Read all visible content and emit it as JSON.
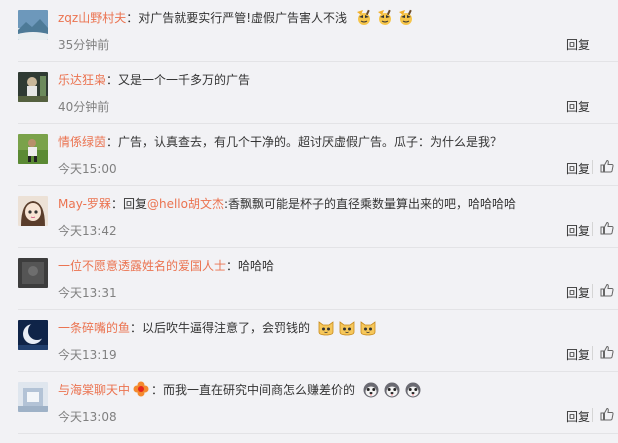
{
  "comments": [
    {
      "user": "zqz山野村夫",
      "separator": "：",
      "text": "对广告就要实行严管!虚假广告害人不浅",
      "emoji": [
        "cheer-emoji",
        "cheer-emoji",
        "cheer-emoji"
      ],
      "time": "35分钟前",
      "reply": "回复",
      "like_icon": false,
      "avatar_color": "#5a86a9"
    },
    {
      "user": "乐达狂枭",
      "separator": "：",
      "text": "又是一个一千多万的广告",
      "emoji": [],
      "time": "40分钟前",
      "reply": "回复",
      "like_icon": false,
      "avatar_color": "#3b4a3e"
    },
    {
      "user": "情係绿茵",
      "separator": "：",
      "text": "广告，认真查去，有几个干净的。超讨厌虚假广告。瓜子：为什么是我？",
      "emoji": [],
      "time": "今天15:00",
      "reply": "回复",
      "like_icon": true,
      "avatar_color": "#6b8f3a"
    },
    {
      "user": "May-罗槑",
      "separator": "：",
      "text_prefix": "回复",
      "mention": "@hello胡文杰",
      "text": ":香飘飘可能是杯子的直径乘数量算出来的吧，哈哈哈哈",
      "emoji": [],
      "time": "今天13:42",
      "reply": "回复",
      "like_icon": true,
      "avatar_color": "#e8d6c8"
    },
    {
      "user": "一位不愿意透露姓名的爱国人士",
      "separator": "：",
      "text": "哈哈哈",
      "emoji": [],
      "time": "今天13:31",
      "reply": "回复",
      "like_icon": true,
      "avatar_color": "#4a4a4a"
    },
    {
      "user": "一条碎嘴的鱼",
      "separator": "：",
      "text": "以后吹牛逼得注意了，会罚钱的",
      "emoji": [
        "cat-emoji",
        "cat-emoji",
        "cat-emoji"
      ],
      "time": "今天13:19",
      "reply": "回复",
      "like_icon": true,
      "avatar_color": "#1d3b6e"
    },
    {
      "user": "与海棠聊天中",
      "separator": "：",
      "text": "而我一直在研究中间商怎么赚差价的",
      "emoji": [
        "husky-emoji",
        "husky-emoji",
        "husky-emoji"
      ],
      "badge": "flower-badge",
      "time": "今天13:08",
      "reply": "回复",
      "like_icon": true,
      "avatar_color": "#b9c6d6"
    }
  ],
  "colors": {
    "username": "#eb7350",
    "text": "#333333",
    "time": "#808080",
    "background": "#f2f2f5"
  }
}
